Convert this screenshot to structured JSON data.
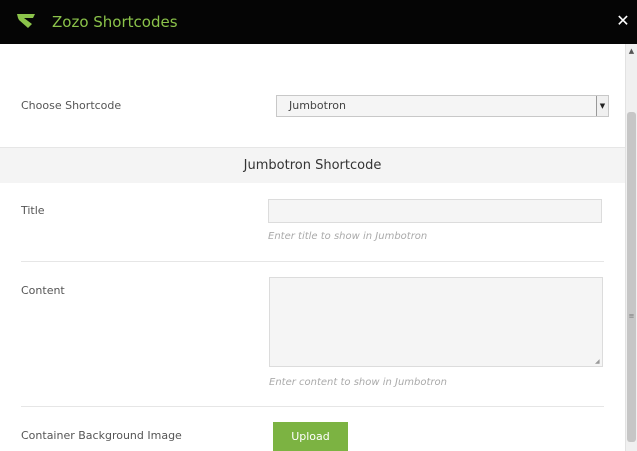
{
  "window": {
    "title": "Zozo Shortcodes",
    "close_glyph": "✕",
    "accent_color": "#8bc34a"
  },
  "icons": {
    "logo": "zozo-logo-icon",
    "close": "close-icon"
  },
  "form": {
    "choose_label": "Choose Shortcode",
    "choose_selected": "Jumbotron",
    "section_title": "Jumbotron Shortcode",
    "title_label": "Title",
    "title_value": "",
    "title_hint": "Enter title to show in Jumbotron",
    "content_label": "Content",
    "content_value": "",
    "content_hint": "Enter content to show in Jumbotron",
    "bg_image_label": "Container Background Image",
    "upload_label": "Upload",
    "upload_color": "#7cb342"
  }
}
